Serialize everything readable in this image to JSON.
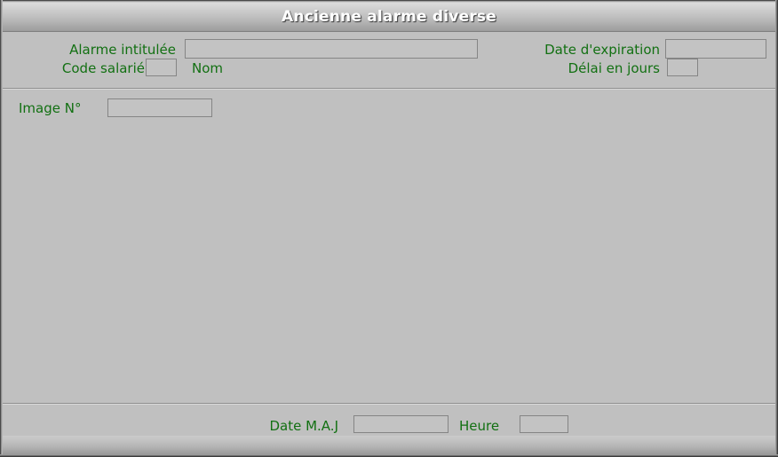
{
  "window": {
    "title": "Ancienne alarme diverse"
  },
  "form": {
    "alarme_intitulee": {
      "label": "Alarme intitulée",
      "value": "",
      "placeholder": ""
    },
    "code_salarie": {
      "label": "Code salarié",
      "value": "",
      "placeholder": ""
    },
    "nom": {
      "label": "Nom",
      "value": "",
      "placeholder": ""
    },
    "date_expiration": {
      "label": "Date d'expiration",
      "value": "",
      "placeholder": ""
    },
    "delai_en_jours": {
      "label": "Délai en jours",
      "value": "",
      "placeholder": ""
    },
    "image_no": {
      "label": "Image N°",
      "value": "",
      "placeholder": ""
    }
  },
  "footer": {
    "date_maj": {
      "label": "Date M.A.J",
      "value": "",
      "placeholder": ""
    },
    "heure": {
      "label": "Heure",
      "value": "",
      "placeholder": ""
    }
  },
  "colors": {
    "background": "#c0c0c0",
    "label_green": "#127012",
    "field_border": "#858585",
    "title_text": "#ffffff"
  }
}
